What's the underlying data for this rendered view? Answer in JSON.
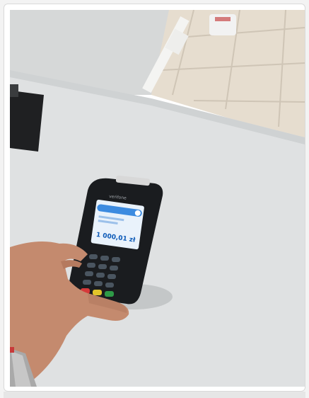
{
  "photo": {
    "terminal_brand": "verifone",
    "screen_amount": "1 000,01 zł"
  },
  "colors": {
    "table": "#dfe1e2",
    "floor": "#e8dfd2",
    "wall": "#d9dbdb",
    "terminal": "#1a1c1f",
    "screen": "#e9f2fb",
    "screen_accent": "#3c8be0"
  }
}
